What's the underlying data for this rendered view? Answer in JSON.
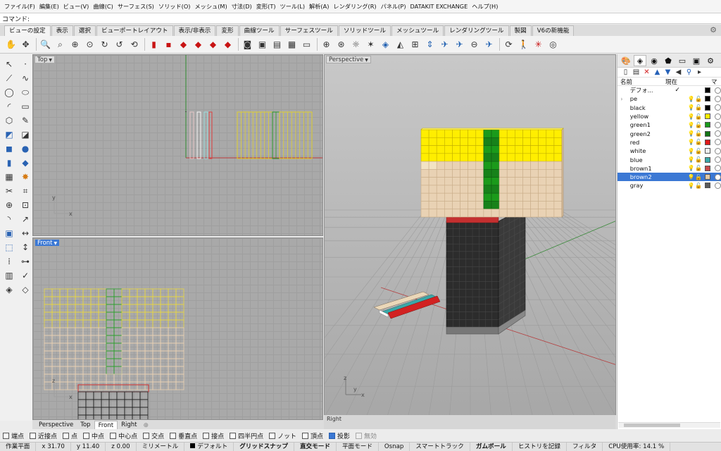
{
  "menu": [
    "ファイル(F)",
    "編集(E)",
    "ビュー(V)",
    "曲線(C)",
    "サーフェス(S)",
    "ソリッド(O)",
    "メッシュ(M)",
    "寸法(D)",
    "変形(T)",
    "ツール(L)",
    "解析(A)",
    "レンダリング(R)",
    "パネル(P)",
    "DATAKIT EXCHANGE",
    "ヘルプ(H)"
  ],
  "command": {
    "label": "コマンド:",
    "value": ""
  },
  "tabs": [
    "ビューの設定",
    "表示",
    "選択",
    "ビューポートレイアウト",
    "表示/非表示",
    "変形",
    "曲線ツール",
    "サーフェスツール",
    "ソリッドツール",
    "メッシュツール",
    "レンダリングツール",
    "製図",
    "V6の新機能"
  ],
  "viewports": {
    "top": {
      "title": "Top"
    },
    "front": {
      "title": "Front"
    },
    "perspective": {
      "title": "Perspective"
    },
    "right": {
      "title": "Right"
    }
  },
  "axes": {
    "x": "x",
    "y": "y",
    "z": "z"
  },
  "viewport_tabs": [
    "Perspective",
    "Top",
    "Front",
    "Right"
  ],
  "osnap": [
    {
      "label": "端点",
      "checked": false
    },
    {
      "label": "近接点",
      "checked": false
    },
    {
      "label": "点",
      "checked": false
    },
    {
      "label": "中点",
      "checked": false
    },
    {
      "label": "中心点",
      "checked": false
    },
    {
      "label": "交点",
      "checked": false
    },
    {
      "label": "垂直点",
      "checked": false
    },
    {
      "label": "接点",
      "checked": false
    },
    {
      "label": "四半円点",
      "checked": false
    },
    {
      "label": "ノット",
      "checked": false
    },
    {
      "label": "頂点",
      "checked": false
    },
    {
      "label": "投影",
      "checked": true
    },
    {
      "label": "無効",
      "checked": false,
      "disabled": true
    }
  ],
  "status": {
    "plane": "作業平面",
    "x": "x 31.70",
    "y": "y 11.40",
    "z": "z 0.00",
    "unit": "ミリメートル",
    "layer": "デフォルト",
    "grid_snap": "グリッドスナップ",
    "ortho": "直交モード",
    "planar": "平面モード",
    "osnap": "Osnap",
    "smarttrack": "スマートトラック",
    "gumball": "ガムボール",
    "history": "ヒストリを記録",
    "filter": "フィルタ",
    "cpu": "CPU使用率: 14.1 %"
  },
  "layers_panel": {
    "col_name": "名前",
    "col_current": "現在",
    "col_material": "マ",
    "layers": [
      {
        "name": "デフォ...",
        "current": true,
        "color": "#000000"
      },
      {
        "name": "pe",
        "color": "#000000",
        "expandable": true
      },
      {
        "name": "black",
        "color": "#000000"
      },
      {
        "name": "yellow",
        "color": "#ffee00"
      },
      {
        "name": "green1",
        "color": "#1b9a1b"
      },
      {
        "name": "green2",
        "color": "#147414"
      },
      {
        "name": "red",
        "color": "#e01818"
      },
      {
        "name": "white",
        "color": "#f0f0f0"
      },
      {
        "name": "blue",
        "color": "#3aa8a8"
      },
      {
        "name": "brown1",
        "color": "#c84848"
      },
      {
        "name": "brown2",
        "color": "#e2c9a6",
        "selected": true
      },
      {
        "name": "gray",
        "color": "#5a5a5a"
      }
    ]
  },
  "colors": {
    "accent": "#3b78d4",
    "yellow": "#ffee00",
    "green": "#1b9a1b",
    "skin": "#e9d2b4",
    "dark": "#2e2e2e"
  }
}
